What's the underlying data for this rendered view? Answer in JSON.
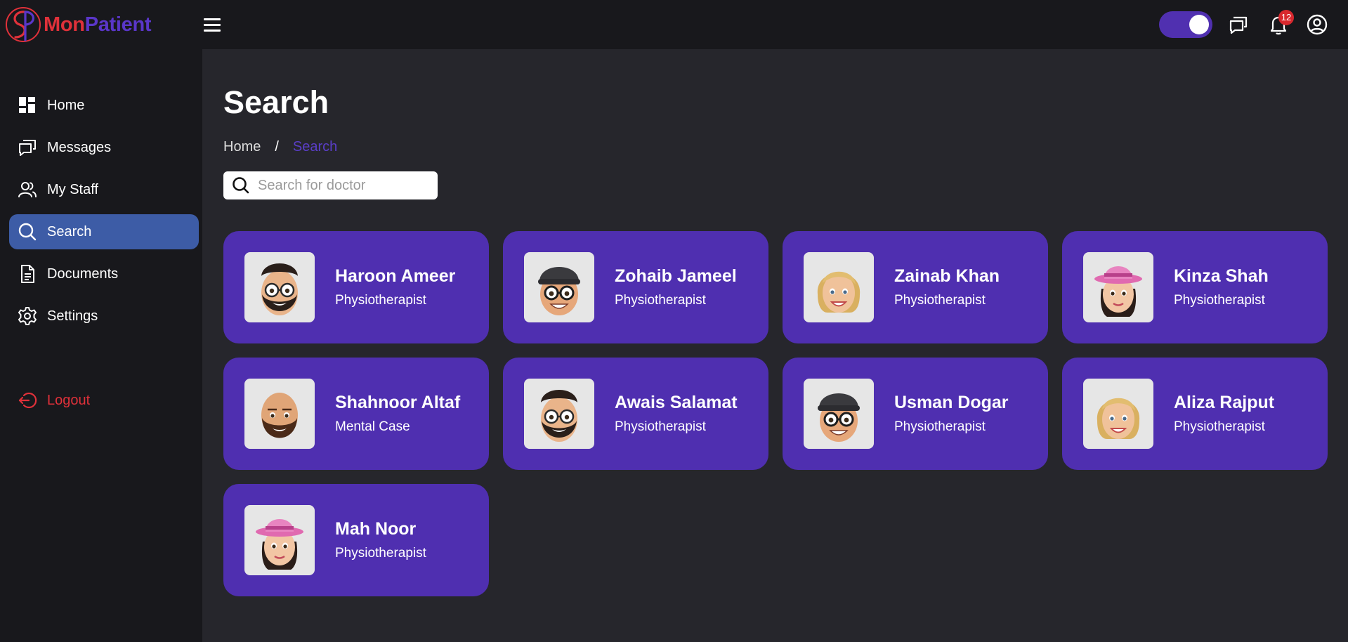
{
  "app": {
    "brand_part1": "Mon",
    "brand_part2": "Patient",
    "notification_count": "12"
  },
  "colors": {
    "brand_red": "#e0313a",
    "brand_purple": "#5a36c9",
    "card_bg": "#4f2fb0",
    "active_nav": "#3d5ca6",
    "sidebar_bg": "#18181c",
    "main_bg": "#26262c"
  },
  "sidebar": {
    "items": [
      {
        "label": "Home",
        "icon": "dashboard-icon"
      },
      {
        "label": "Messages",
        "icon": "chat-icon"
      },
      {
        "label": "My Staff",
        "icon": "people-icon"
      },
      {
        "label": "Search",
        "icon": "search-icon",
        "active": true
      },
      {
        "label": "Documents",
        "icon": "document-icon"
      },
      {
        "label": "Settings",
        "icon": "gear-icon"
      }
    ],
    "logout_label": "Logout"
  },
  "main": {
    "title": "Search",
    "breadcrumb": {
      "home": "Home",
      "separator": "/",
      "current": "Search"
    },
    "search_placeholder": "Search for doctor",
    "search_value": ""
  },
  "doctors": [
    {
      "name": "Haroon Ameer",
      "role": "Physiotherapist",
      "avatar": "bearded-glasses"
    },
    {
      "name": "Zohaib Jameel",
      "role": "Physiotherapist",
      "avatar": "cap-glasses"
    },
    {
      "name": "Zainab Khan",
      "role": "Physiotherapist",
      "avatar": "blonde"
    },
    {
      "name": "Kinza Shah",
      "role": "Physiotherapist",
      "avatar": "pink-hat"
    },
    {
      "name": "Shahnoor Altaf",
      "role": "Mental Case",
      "avatar": "bald-beard"
    },
    {
      "name": "Awais Salamat",
      "role": "Physiotherapist",
      "avatar": "bearded-glasses"
    },
    {
      "name": "Usman Dogar",
      "role": "Physiotherapist",
      "avatar": "cap-glasses"
    },
    {
      "name": "Aliza Rajput",
      "role": "Physiotherapist",
      "avatar": "blonde"
    },
    {
      "name": "Mah Noor",
      "role": "Physiotherapist",
      "avatar": "pink-hat"
    }
  ]
}
